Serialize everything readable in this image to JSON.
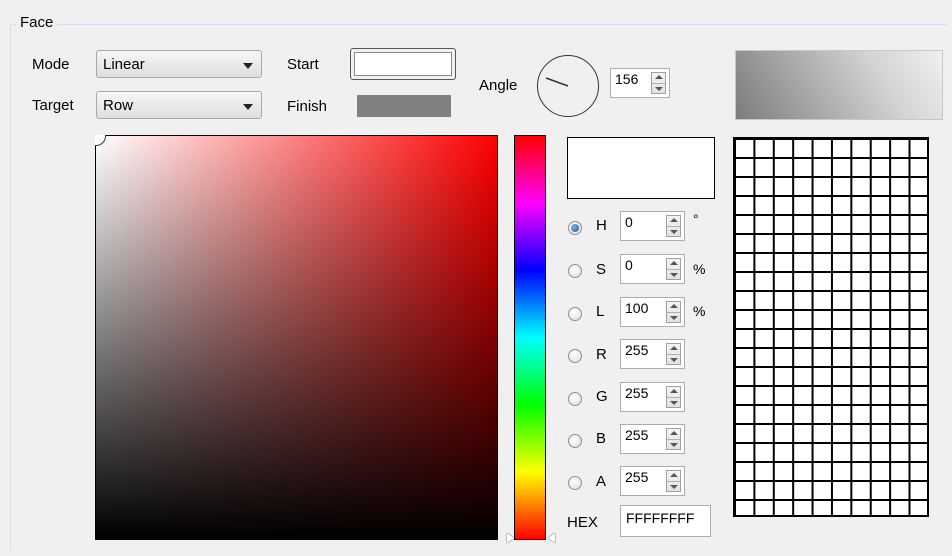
{
  "group": {
    "title": "Face"
  },
  "mode": {
    "label": "Mode",
    "value": "Linear"
  },
  "target": {
    "label": "Target",
    "value": "Row"
  },
  "start": {
    "label": "Start",
    "color": "#ffffff"
  },
  "finish": {
    "label": "Finish",
    "color": "#808080"
  },
  "angle": {
    "label": "Angle",
    "value": "156"
  },
  "channels": {
    "h": {
      "label": "H",
      "value": "0",
      "unit": "°",
      "checked": true
    },
    "s": {
      "label": "S",
      "value": "0",
      "unit": "%"
    },
    "l": {
      "label": "L",
      "value": "100",
      "unit": "%"
    },
    "r": {
      "label": "R",
      "value": "255"
    },
    "g": {
      "label": "G",
      "value": "255"
    },
    "b": {
      "label": "B",
      "value": "255"
    },
    "a": {
      "label": "A",
      "value": "255"
    }
  },
  "hex": {
    "label": "HEX",
    "value": "FFFFFFFF"
  },
  "current_color": "#ffffff",
  "icons": [
    "dropdown-arrow-icon",
    "spin-up-icon",
    "spin-down-icon",
    "hue-marker-icon"
  ]
}
